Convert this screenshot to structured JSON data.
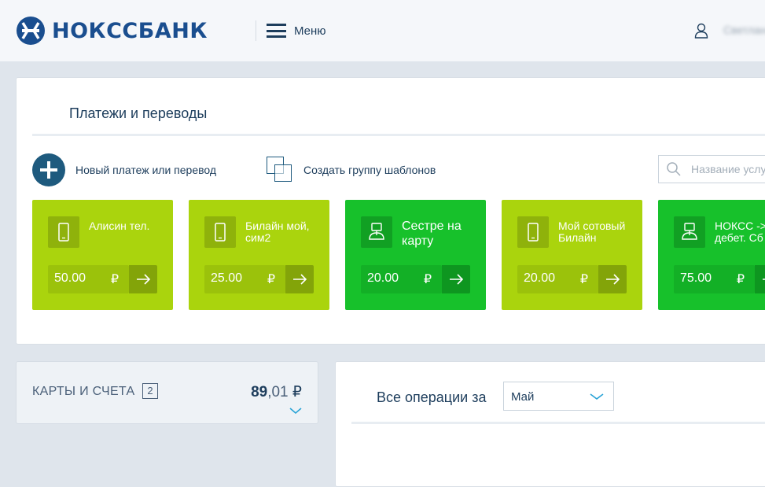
{
  "header": {
    "logo_text": "НОКССБАНК",
    "menu_label": "Меню",
    "user_name": "Светлана"
  },
  "payments": {
    "title": "Платежи и переводы",
    "new_payment_label": "Новый платеж или перевод",
    "create_group_label": "Создать группу шаблонов",
    "search_placeholder": "Название услуги",
    "templates": [
      {
        "name": "Алисин тел.",
        "amount": "50.00",
        "currency": "₽",
        "icon": "phone-icon",
        "color": "#aad40d"
      },
      {
        "name": "Билайн мой, сим2",
        "amount": "25.00",
        "currency": "₽",
        "icon": "phone-icon",
        "color": "#aad40d"
      },
      {
        "name": "Сестре на карту",
        "amount": "20.00",
        "currency": "₽",
        "icon": "hand-card-icon",
        "color": "#17c12b"
      },
      {
        "name": "Мой сотовый Билайн",
        "amount": "20.00",
        "currency": "₽",
        "icon": "phone-icon",
        "color": "#aad40d"
      },
      {
        "name": "НОКСС -> дебет. Сб",
        "amount": "75.00",
        "currency": "₽",
        "icon": "hand-card-icon",
        "color": "#17c12b"
      }
    ]
  },
  "cards": {
    "title": "КАРТЫ И СЧЕТА",
    "count": "2",
    "balance_int": "89",
    "balance_frac": ",01",
    "currency": "₽"
  },
  "operations": {
    "title": "Все операции за",
    "selected_month": "Май"
  },
  "colors": {
    "brand": "#1a4e8f",
    "accent_dark": "#1e5a7e",
    "tile_lime": "#aad40d",
    "tile_green": "#17c12b"
  }
}
